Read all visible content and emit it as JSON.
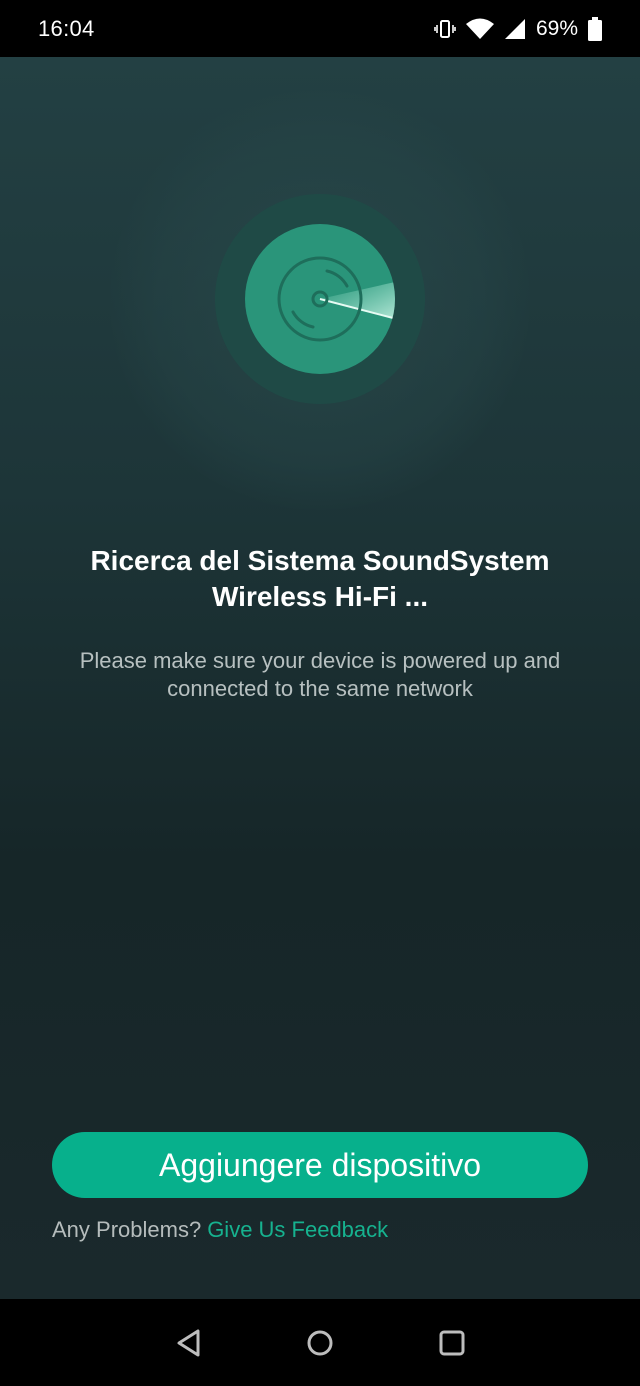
{
  "status_bar": {
    "time": "16:04",
    "battery": "69%",
    "icons": [
      "vibrate-icon",
      "wifi-icon",
      "signal-icon",
      "battery-icon"
    ]
  },
  "radar": {
    "icon": "speaker-radar-icon",
    "accent": "#2a957a"
  },
  "content": {
    "title_line1": "Ricerca del Sistema SoundSystem",
    "title_line2": "Wireless Hi-Fi  ...",
    "subtitle_line1": "Please make sure your device is powered up and",
    "subtitle_line2": "connected to the same network"
  },
  "actions": {
    "add_device_label": "Aggiungere dispositivo",
    "problems_text": "Any Problems?",
    "feedback_link": "Give Us Feedback"
  },
  "colors": {
    "accent": "#07b08c",
    "link": "#16b28f"
  },
  "nav_bar": {
    "icons": [
      "back-icon",
      "home-icon",
      "recents-icon"
    ]
  }
}
